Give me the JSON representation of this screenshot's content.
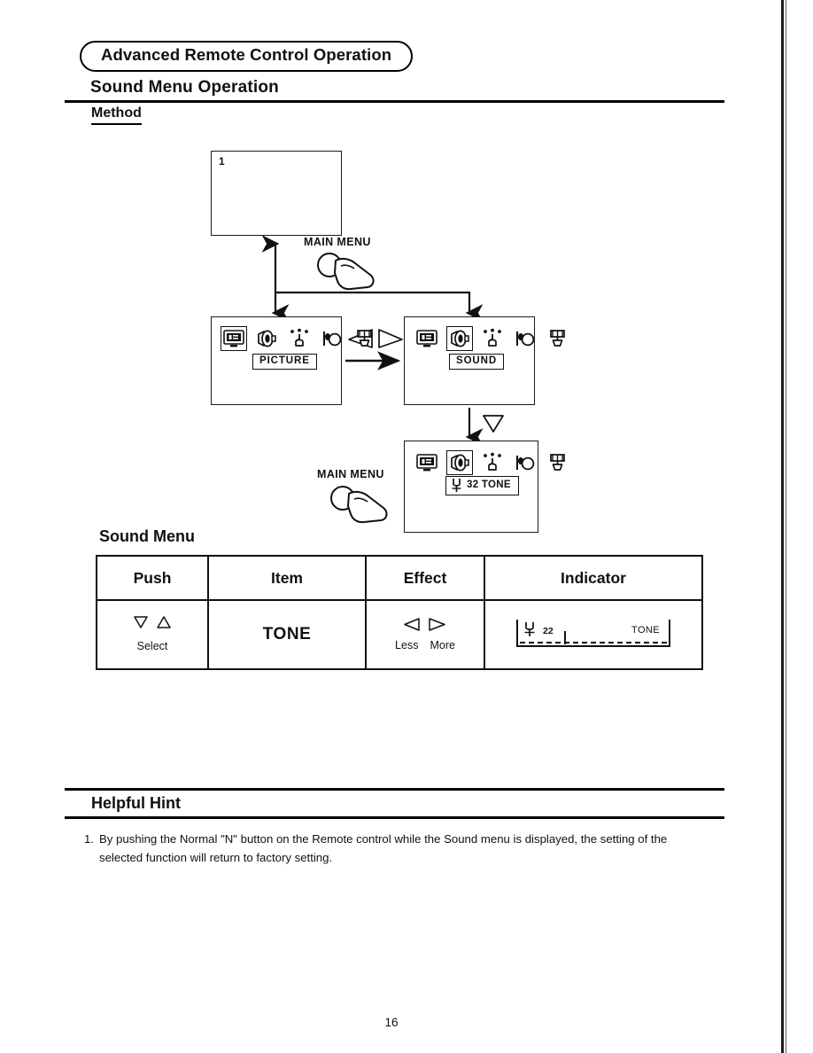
{
  "page": {
    "banner": "Advanced Remote Control Operation",
    "section_title": "Sound Menu Operation",
    "sub_title": "Method",
    "page_number": "16"
  },
  "diagram": {
    "screen1_number": "1",
    "press_label_1": "MAIN MENU",
    "press_label_2": "MAIN MENU",
    "screens": [
      {
        "id": "picture",
        "label": "PICTURE",
        "selected_icon_index": 0
      },
      {
        "id": "sound",
        "label": "SOUND",
        "selected_icon_index": 1
      },
      {
        "id": "tone",
        "label": "TONE",
        "value": "32",
        "selected_icon_index": 1
      }
    ],
    "icons": [
      "picture-monitor-icon",
      "sound-speaker-icon",
      "tuner-antenna-icon",
      "timer-clock-icon",
      "setup-icon"
    ],
    "tone_label_text": "32 TONE"
  },
  "table": {
    "title": "Sound Menu",
    "headers": [
      "Push",
      "Item",
      "Effect",
      "Indicator"
    ],
    "rows": [
      {
        "push": "Select",
        "item": "TONE",
        "effect_less": "Less",
        "effect_more": "More",
        "indicator_value": "22",
        "indicator_name": "TONE"
      }
    ]
  },
  "hint": {
    "title": "Helpful Hint",
    "items": [
      {
        "number": "1.",
        "text": "By pushing the Normal \"N\" button on the Remote control while the Sound menu is displayed, the setting of the selected function will return to factory setting."
      }
    ]
  }
}
